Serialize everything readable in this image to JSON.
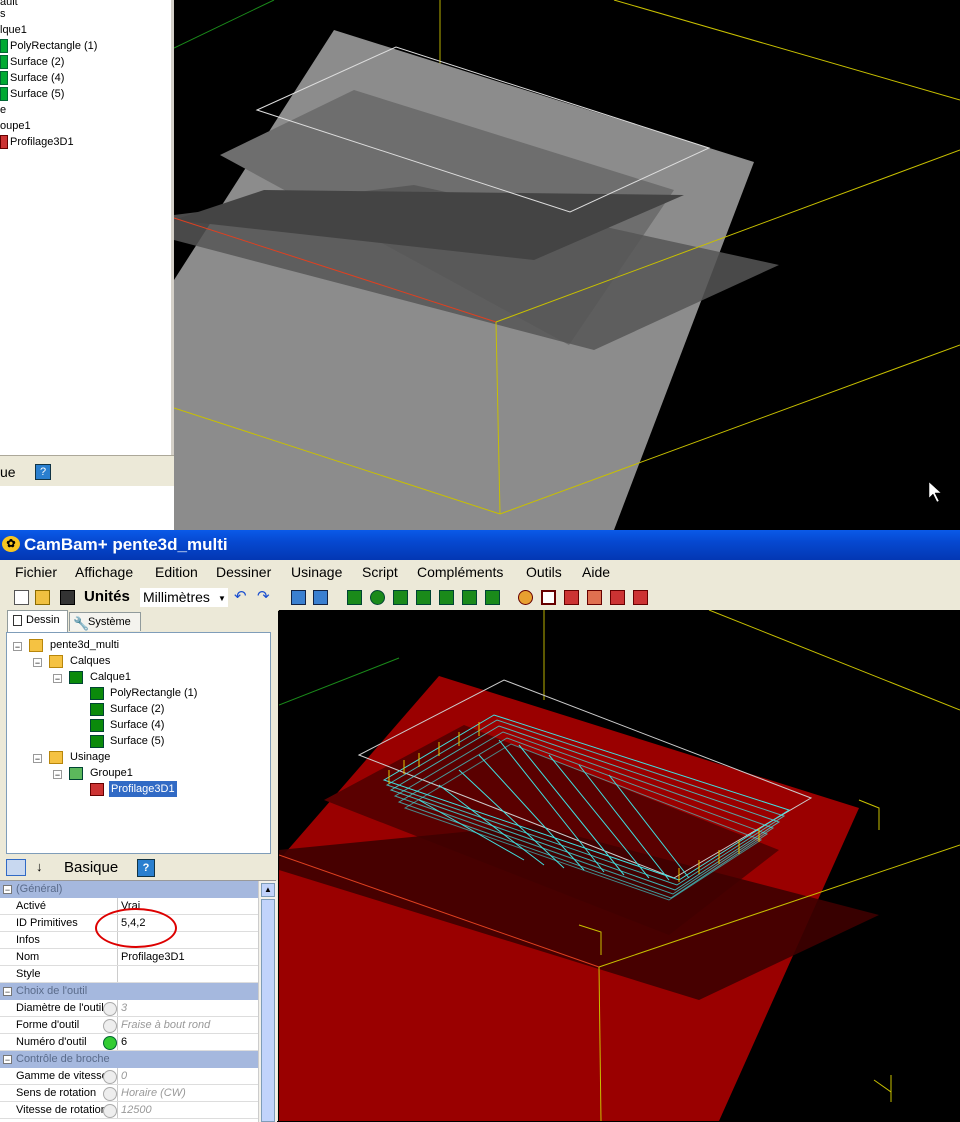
{
  "top_window": {
    "tree": {
      "rows": [
        "ault",
        "s",
        "lque1",
        "PolyRectangle (1)",
        "Surface (2)",
        "Surface (4)",
        "Surface (5)",
        "e",
        "oupe1",
        "Profilage3D1"
      ]
    },
    "props_bar": {
      "label": "ue",
      "help": "?"
    }
  },
  "window": {
    "title": "CamBam+  pente3d_multi"
  },
  "menu": [
    "Fichier",
    "Affichage",
    "Edition",
    "Dessiner",
    "Usinage",
    "Script",
    "Compléments",
    "Outils",
    "Aide"
  ],
  "toolbar": {
    "units_label": "Unités",
    "units_value": "Millimètres"
  },
  "tabs": [
    "Dessin",
    "Système"
  ],
  "tree": {
    "root": "pente3d_multi",
    "calques": "Calques",
    "calque1": "Calque1",
    "items": [
      "PolyRectangle (1)",
      "Surface (2)",
      "Surface (4)",
      "Surface (5)"
    ],
    "usinage": "Usinage",
    "groupe1": "Groupe1",
    "op": "Profilage3D1"
  },
  "props": {
    "view_label": "Basique",
    "help": "?",
    "categories": [
      "(Général)",
      "Choix de l'outil",
      "Contrôle de broche"
    ],
    "general": [
      {
        "k": "Activé",
        "v": "Vrai"
      },
      {
        "k": "ID Primitives",
        "v": "5,4,2"
      },
      {
        "k": "Infos",
        "v": ""
      },
      {
        "k": "Nom",
        "v": "Profilage3D1"
      },
      {
        "k": "Style",
        "v": ""
      }
    ],
    "outil": [
      {
        "k": "Diamètre de l'outil",
        "v": "3"
      },
      {
        "k": "Forme d'outil",
        "v": "Fraise à bout rond"
      },
      {
        "k": "Numéro d'outil",
        "v": "6"
      }
    ],
    "broche": [
      {
        "k": "Gamme de vitesse",
        "v": "0"
      },
      {
        "k": "Sens de rotation",
        "v": "Horaire (CW)"
      },
      {
        "k": "Vitesse de rotation",
        "v": "12500"
      }
    ]
  },
  "colors": {
    "titlebar": "#0648d0",
    "highlight": "#dd0000",
    "model_top": "#888888",
    "model_bottom": "#a00000",
    "toolpath": "#40e0e0"
  }
}
